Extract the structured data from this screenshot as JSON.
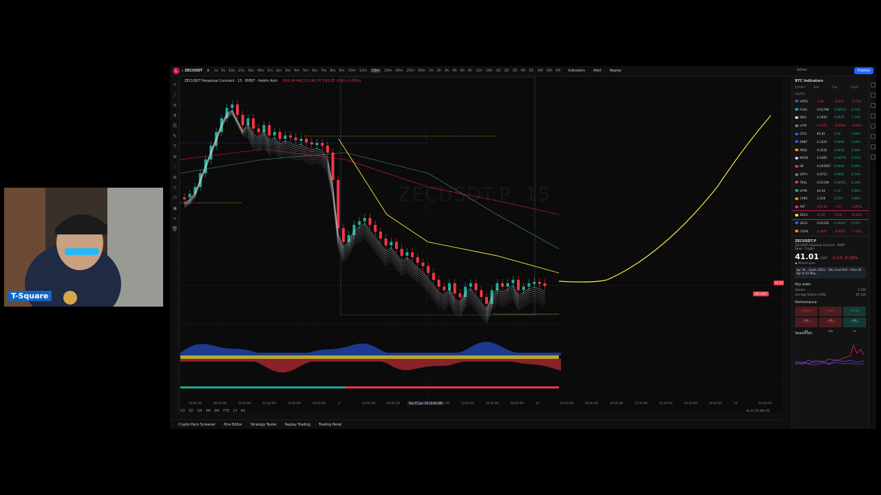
{
  "topbar": {
    "symbol": "ZECUSDT",
    "timeframes": [
      "1s",
      "5s",
      "10s",
      "15s",
      "30s",
      "45s",
      "1m",
      "2m",
      "3m",
      "4m",
      "5m",
      "6m",
      "7m",
      "8m",
      "9m",
      "10m",
      "12m",
      "15m",
      "20m",
      "24m",
      "25m",
      "30m",
      "1h",
      "2h",
      "3h",
      "4h",
      "6h",
      "8h",
      "12h",
      "16h",
      "1D",
      "2D",
      "3D",
      "4D",
      "5D",
      "1W",
      "2W",
      "1M"
    ],
    "active_timeframe": "15m",
    "indicators_label": "Indicators",
    "alert_label": "Alert",
    "replay_label": "Replay",
    "account_label": "tether",
    "publish_label": "Publish"
  },
  "legend": {
    "title": "ZECUSDT Perpetual Contract · 15 · BYBIT · Heikin Ashi",
    "ohlc": "O41.04 H41.13 L41.07 C41.03 -0.00 (-0.00%)"
  },
  "watermark": "ZECUSDT.P, 15",
  "price_labels": {
    "current": "41.01",
    "tag": "ZECUSDT"
  },
  "time_axis": [
    "06:00 AM",
    "09:00 AM",
    "12:00 PM",
    "03:00 PM",
    "06:00 PM",
    "09:00 PM",
    "17",
    "03:00 AM",
    "06:00 AM",
    "Tue 17 Jun '25",
    "10:30 AM",
    "03:00 PM",
    "06:00 PM",
    "09:00 PM",
    "18",
    "03:00 AM",
    "06:00 AM",
    "09:00 AM",
    "12:00 PM",
    "03:00 PM",
    "06:00 PM",
    "09:00 PM",
    "19",
    "03:00 AM"
  ],
  "highlight_time": "Tue 17 Jun '25   10:30 AM",
  "range_buttons": [
    "1D",
    "5D",
    "1M",
    "3M",
    "6M",
    "YTD",
    "1Y",
    "All"
  ],
  "utc_time": "02:47:20 AM UTC",
  "bottom_tabs": [
    "Crypto Pairs Screener",
    "Pine Editor",
    "Strategy Tester",
    "Replay Trading",
    "Trading Panel"
  ],
  "watchlist": {
    "title": "BTC Indicators",
    "columns": [
      "Symbol",
      "Last",
      "Chg",
      "Chg%"
    ],
    "section": "ALERTS",
    "rows": [
      {
        "sym": "VIRTU",
        "last": "1.68",
        "chg": "-0.010",
        "pct": "-0.75%",
        "dir": "neg",
        "dot": "#2962ff"
      },
      {
        "sym": "FLRU",
        "last": "0.01799",
        "chg": "0.00013",
        "pct": "0.73%",
        "dir": "pos",
        "dot": "#22ab94"
      },
      {
        "sym": "SEIU",
        "last": "0.1693",
        "chg": "0.0029",
        "pct": "1.74%",
        "dir": "pos",
        "dot": "#d1d4dc"
      },
      {
        "sym": "LAYE",
        "last": "0.4345",
        "chg": "-0.0004",
        "pct": "-0.09%",
        "dir": "neg",
        "dot": "#787b86"
      },
      {
        "sym": "LTCU",
        "last": "85.81",
        "chg": "0.92",
        "pct": "1.09%",
        "dir": "pos",
        "dot": "#2962ff"
      },
      {
        "sym": "ARBT",
        "last": "0.1525",
        "chg": "0.0000",
        "pct": "0.00%",
        "dir": "pos",
        "dot": "#2962ff"
      },
      {
        "sym": "PRSE",
        "last": "0.3535",
        "chg": "0.0033",
        "pct": "0.94%",
        "dir": "pos",
        "dot": "#ff9800"
      },
      {
        "sym": "MOVE",
        "last": "0.1465",
        "chg": "0.00075",
        "pct": "0.51%",
        "dir": "pos",
        "dot": "#d1d4dc"
      },
      {
        "sym": "HE",
        "last": "0.003567",
        "chg": "0.0000",
        "pct": "0.00%",
        "dir": "pos",
        "dot": "#f23645"
      },
      {
        "sym": "SXTU",
        "last": "0.0715",
        "chg": "0.0001",
        "pct": "0.14%",
        "dir": "pos",
        "dot": "#787b86"
      },
      {
        "sym": "TRXL",
        "last": "0.01198",
        "chg": "0.00052",
        "pct": "4.34%",
        "dir": "pos",
        "dot": "#f23645"
      },
      {
        "sym": "HYPE",
        "last": "40.26",
        "chg": "0.32",
        "pct": "0.80%",
        "dir": "pos",
        "dot": "#22ab94"
      },
      {
        "sym": "CAKE",
        "last": "2.228",
        "chg": "0.019",
        "pct": "0.86%",
        "dir": "pos",
        "dot": "#ff9800"
      },
      {
        "sym": "AST",
        "last": "375.18",
        "chg": "-7.07",
        "pct": "-1.85%",
        "dir": "neg",
        "dot": "#f23645"
      },
      {
        "sym": "ZECU",
        "last": "41.01",
        "chg": "-0.14",
        "pct": "-0.34%",
        "dir": "neg",
        "dot": "#ffeb3b",
        "sel": true
      },
      {
        "sym": "VELO",
        "last": "0.01150",
        "chg": "0.00007",
        "pct": "0.65%",
        "dir": "pos",
        "dot": "#2962ff"
      },
      {
        "sym": "COOK",
        "last": "0.1835",
        "chg": "-0.0027",
        "pct": "-1.45%",
        "dir": "neg",
        "dot": "#ff9800"
      }
    ]
  },
  "detail": {
    "symbol": "ZECUSDT.P",
    "subtitle": "ZECUSDT Perpetual Contract · BYBIT",
    "sub2": "Swap · Crypto",
    "price": "41.01",
    "unit": "USDT",
    "change": "-0.14  -0.34%",
    "market": "● Market open",
    "news": "Apr 26 – Zcash (ZEC) – Dev Fund Poll – From 26 Apr to 01 May...",
    "key_stats_title": "Key stats",
    "volume_label": "Volume",
    "volume_value": "1.15K",
    "avg_volume_label": "Average Volume (30D)",
    "avg_volume_value": "81.51K",
    "performance_title": "Performance",
    "perf": [
      {
        "v": "-20.82%",
        "l": "1W",
        "dir": "neg"
      },
      {
        "v": "-1.08%",
        "l": "1M",
        "dir": "neg"
      },
      {
        "v": "19.59%",
        "l": "3M",
        "dir": "pos"
      },
      {
        "v": "-10.30%",
        "l": "6M",
        "dir": "neg"
      },
      {
        "v": "-27.38%",
        "l": "YTD",
        "dir": "neg"
      },
      {
        "v": "35.39%",
        "l": "1Y",
        "dir": "pos"
      }
    ],
    "seasonals_title": "Seasonals"
  },
  "webcam": {
    "name": "T-Square"
  },
  "colors": {
    "up": "#22ab94",
    "down": "#f23645",
    "accent": "#2962ff",
    "projection": "#ffeb3b"
  }
}
